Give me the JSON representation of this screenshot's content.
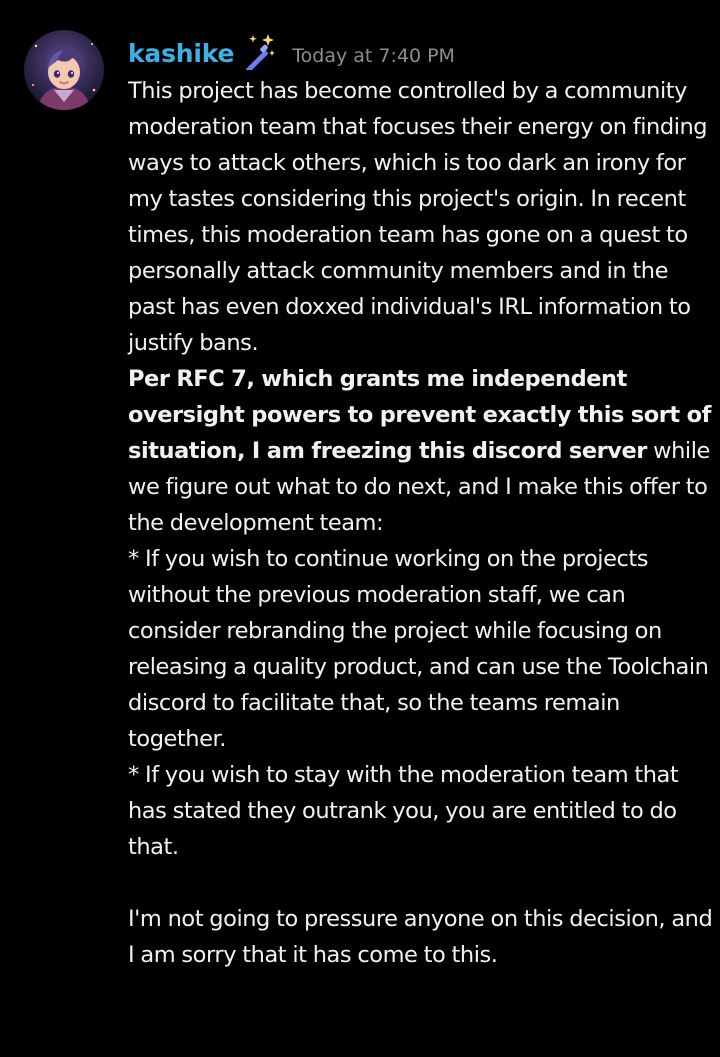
{
  "message": {
    "author": "kashike",
    "badge_icon": "magic-wand-sparkle-icon",
    "timestamp": "Today at 7:40 PM",
    "paragraph_1": "This project has become controlled by a community moderation team that focuses their energy on finding ways to attack others, which is too dark an irony for my tastes considering this project's origin. In recent times, this moderation team has gone on a quest to personally attack community members and in the past has even doxxed individual's IRL information to justify bans.",
    "bold_statement": "Per RFC 7, which grants me independent oversight powers to prevent exactly this sort of situation, I am freezing this discord server",
    "paragraph_2_rest": " while we figure out what to do next, and I make this offer to the development team:",
    "bullet_1": "* If you wish to continue working on the projects without the previous moderation staff, we can consider rebranding the project while focusing on releasing a quality product, and can use the Toolchain discord to facilitate that, so the teams remain together.",
    "bullet_2": "* If you wish to stay with the moderation team that has stated they outrank you, you are entitled to do that.",
    "closing": "I'm not going to pressure anyone on this decision, and I am sorry that it has come to this."
  },
  "colors": {
    "background": "#000000",
    "username": "#3fb0e6",
    "timestamp": "#8a8d93",
    "text": "#f1f1f2",
    "badge": "#6f7bf0"
  }
}
